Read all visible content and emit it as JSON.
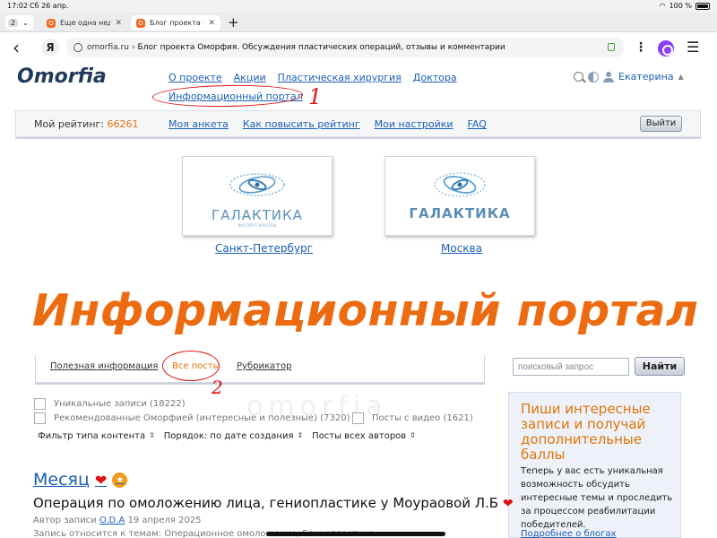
{
  "status": {
    "time": "17:02",
    "date": "Сб 26 апр.",
    "battery": "100 %"
  },
  "tabs": {
    "count": "2",
    "items": [
      {
        "title": "Еще одна недел..."
      },
      {
        "title": "Блог проекта О..."
      }
    ]
  },
  "address": {
    "domain": "omorfia.ru",
    "separator": "›",
    "page_title": "Блог проекта Оморфия. Обсуждения пластических операций, отзывы и комментарии"
  },
  "site": {
    "logo": "Omorfia",
    "nav": [
      "О проекте",
      "Акции",
      "Пластическая хирургия",
      "Доктора"
    ],
    "info_portal": "Информационный портал",
    "user": "Екатерина"
  },
  "annotations": {
    "one": "1",
    "two": "2"
  },
  "ratingbar": {
    "label": "Мой рейтинг:",
    "value": "66261",
    "links": [
      "Моя анкета",
      "Как повысить рейтинг",
      "Мои настройки",
      "FAQ"
    ],
    "logout": "Выйти"
  },
  "clinics": [
    {
      "brand": "ГАЛАКТИКА",
      "subtitle": "ИНСТИТУТ КРАСОТЫ",
      "city": "Санкт-Петербург"
    },
    {
      "brand": "ГАЛАКТИКА",
      "subtitle": "",
      "city": "Москва"
    }
  ],
  "hero": "Информационный портал",
  "filters": {
    "tabs": [
      "Полезная информация",
      "Все посты",
      "Рубрикатор"
    ],
    "active_tab": "Все посты",
    "search_placeholder": "поисковый запрос",
    "search_button": "Найти",
    "checkboxes": [
      {
        "label": "Уникальные записи (18222)",
        "checked": false
      },
      {
        "label": "Рекомендованные Оморфией (интересные и полезные) (7320)",
        "checked": false
      },
      {
        "label": "Посты с видео (1621)",
        "checked": false
      }
    ],
    "content_type": "Фильтр типа контента",
    "order": "Порядок: по дате создания",
    "authors": "Посты всех авторов"
  },
  "sidebar": {
    "heading": "Пиши интересные записи и получай дополнительные баллы",
    "text": "Теперь у вас есть уникальная возможность обсудить интересные темы и проследить за процессом реабилитации победителей.",
    "link": "Подробнее о блогах"
  },
  "post": {
    "month": "Месяц",
    "title": "Операция по омоложению лица, гениопластике у Моураовой Л.Б",
    "author_label": "Автор записи",
    "author": "O.D.A",
    "date": "19 апреля 2025",
    "topics": "Запись относится к темам: Операционное омоложение, Гениопластика"
  },
  "colors": {
    "accent": "#ec6b10",
    "link": "#1a5fb4",
    "annotation": "#dd1111"
  }
}
